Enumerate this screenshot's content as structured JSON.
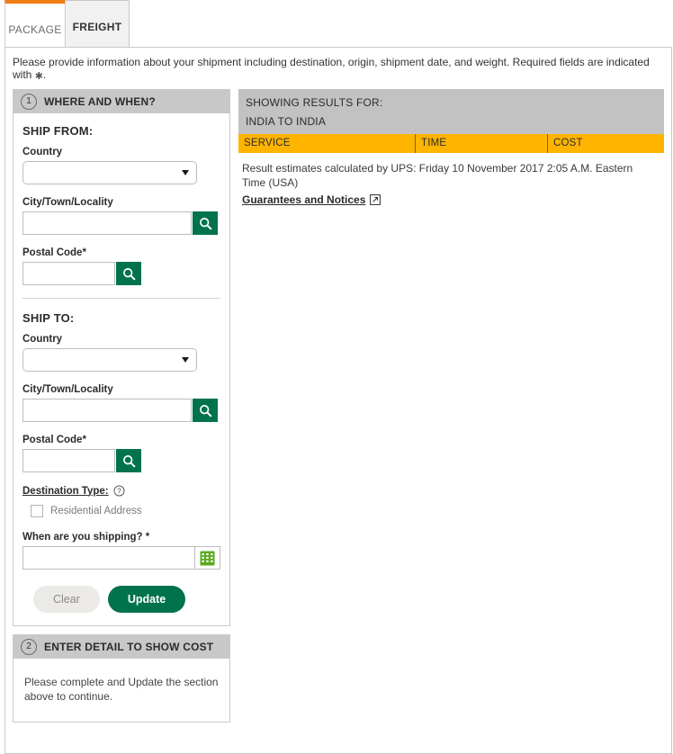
{
  "tabs": [
    {
      "id": "package",
      "label": "PACKAGE",
      "active": true
    },
    {
      "id": "freight",
      "label": "FREIGHT",
      "active": false
    }
  ],
  "intro": {
    "text": "Please provide information about your shipment including destination, origin, shipment date, and weight. Required fields are indicated with",
    "required_marker": "✱",
    "trailing": "."
  },
  "step1": {
    "number": "1",
    "title": "WHERE AND WHEN?",
    "ship_from": {
      "heading": "SHIP FROM:",
      "country_label": "Country",
      "country_value": "",
      "city_label": "City/Town/Locality",
      "city_value": "",
      "city_placeholder": "",
      "postal_label": "Postal Code*",
      "postal_value": "",
      "postal_placeholder": ""
    },
    "ship_to": {
      "heading": "SHIP TO:",
      "country_label": "Country",
      "country_value": "",
      "city_label": "City/Town/Locality",
      "city_value": "",
      "city_placeholder": "",
      "postal_label": "Postal Code*",
      "postal_value": "",
      "postal_placeholder": ""
    },
    "destination_type_label": "Destination Type:",
    "residential_label": "Residential Address",
    "residential_checked": false,
    "shipping_date_label": "When are you shipping? *",
    "shipping_date_value": "",
    "shipping_date_placeholder": "",
    "clear_label": "Clear",
    "update_label": "Update"
  },
  "step2": {
    "number": "2",
    "title": "ENTER DETAIL TO SHOW COST",
    "message": "Please complete and Update the section above to continue."
  },
  "results": {
    "showing_label": "SHOWING RESULTS FOR:",
    "route": "INDIA TO INDIA",
    "columns": [
      "SERVICE",
      "TIME",
      "COST"
    ],
    "rows": [],
    "note": "Result estimates calculated by UPS:  Friday 10 November 2017 2:05 A.M.  Eastern Time (USA)",
    "guarantees_link": "Guarantees and Notices"
  },
  "colors": {
    "tab_accent_orange": "#f07d14",
    "table_header_orange": "#ffb400",
    "ups_green": "#00734d",
    "panel_header_gray": "#c8c8c8",
    "results_header_gray": "#c2c2c2"
  },
  "icons": {
    "search": "search-icon",
    "calendar": "calendar-icon",
    "info": "info-icon",
    "external_link": "external-link-icon",
    "dropdown": "chevron-down-icon"
  }
}
